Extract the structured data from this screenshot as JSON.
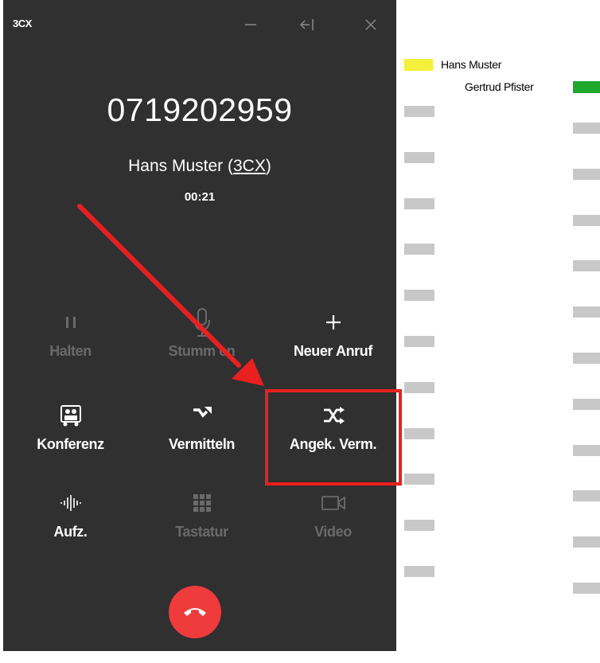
{
  "window": {
    "app_title": "3CX",
    "controls": {
      "minimize_icon": "minimize-icon",
      "dock_icon": "dock-left-icon",
      "close_icon": "close-icon"
    }
  },
  "call": {
    "number": "0719202959",
    "caller_name": "Hans Muster",
    "caller_company": "3CX",
    "timer": "00:21"
  },
  "actions": [
    {
      "label": "Halten",
      "icon": "pause-icon",
      "enabled": false
    },
    {
      "label": "Stumm en",
      "icon": "microphone-icon",
      "enabled": false
    },
    {
      "label": "Neuer Anruf",
      "icon": "plus-icon",
      "enabled": true
    },
    {
      "label": "Konferenz",
      "icon": "conference-icon",
      "enabled": true
    },
    {
      "label": "Vermitteln",
      "icon": "transfer-icon",
      "enabled": true
    },
    {
      "label": "Angek. Verm.",
      "icon": "shuffle-icon",
      "enabled": true,
      "highlighted": true
    },
    {
      "label": "Aufz.",
      "icon": "waveform-icon",
      "enabled": true
    },
    {
      "label": "Tastatur",
      "icon": "dialpad-icon",
      "enabled": false
    },
    {
      "label": "Video",
      "icon": "video-camera-icon",
      "enabled": false
    }
  ],
  "hangup": {
    "icon": "hangup-phone-icon",
    "color": "#ef3b3b"
  },
  "annotation": {
    "color": "#e8201f"
  },
  "diagram": {
    "legend": [
      {
        "name": "Hans Muster",
        "color": "#f5f03a"
      },
      {
        "name": "Gertrud Pfister",
        "color": "#1fa72e"
      }
    ]
  },
  "colors": {
    "window_bg": "#303030",
    "text_enabled": "#ffffff",
    "text_disabled": "#6a6a6a"
  }
}
